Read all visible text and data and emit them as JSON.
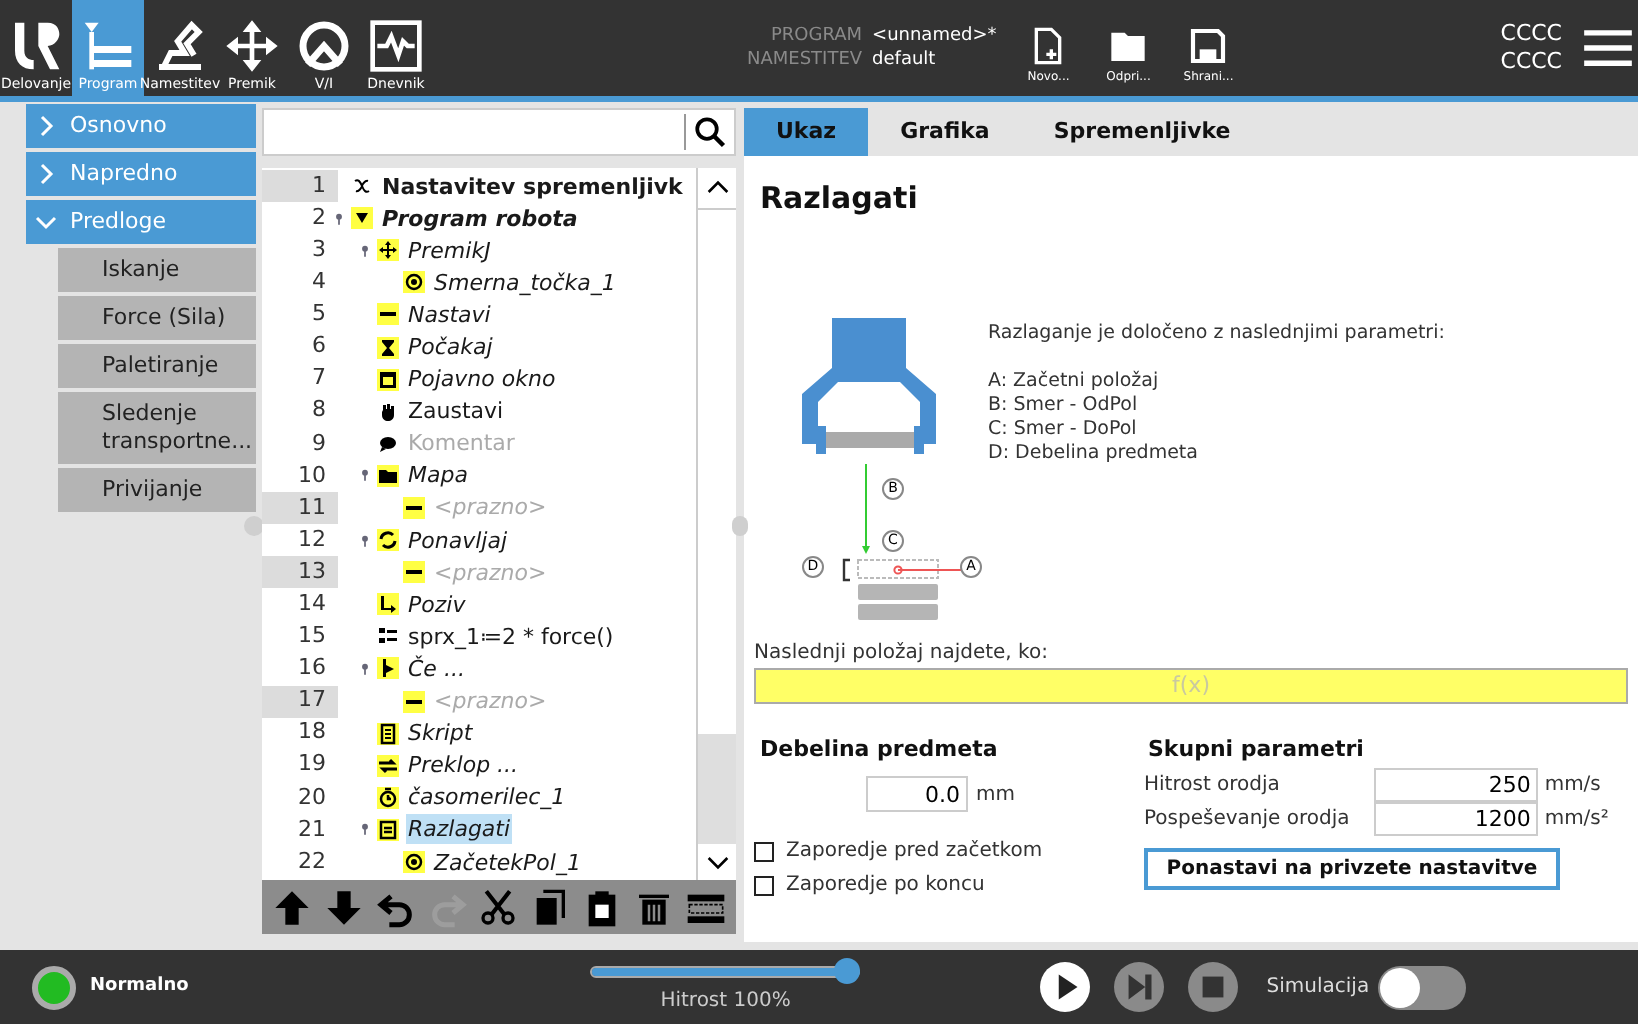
{
  "nav_tabs": [
    {
      "label": "Delovanje",
      "selected": false
    },
    {
      "label": "Program",
      "selected": true
    },
    {
      "label": "Namestitev",
      "selected": false
    },
    {
      "label": "Premik",
      "selected": false
    },
    {
      "label": "V/I",
      "selected": false
    },
    {
      "label": "Dnevnik",
      "selected": false
    }
  ],
  "program_info": [
    {
      "label": "PROGRAM",
      "value": "<unnamed>*"
    },
    {
      "label": "NAMESTITEV",
      "value": "default"
    }
  ],
  "file_buttons": [
    "Novo...",
    "Odpri...",
    "Shrani..."
  ],
  "header_texts": [
    "CCCC",
    "CCCC"
  ],
  "sidebar": [
    {
      "label": "Osnovno",
      "expanded": false
    },
    {
      "label": "Napredno",
      "expanded": false
    },
    {
      "label": "Predloge",
      "expanded": true,
      "children": [
        "Iskanje",
        "Force (Sila)",
        "Paletiranje",
        "Sledenje transportne...",
        "Privijanje"
      ]
    }
  ],
  "tree": [
    {
      "num": "1",
      "label": "Nastavitev spremenljivk",
      "kind": "vars",
      "bold": true,
      "italic": false,
      "greyed": false,
      "marked": true,
      "selected": false
    },
    {
      "num": "2",
      "label": "Program robota",
      "kind": "main",
      "bold": true,
      "italic": true,
      "greyed": false,
      "marked": false,
      "selected": false,
      "children": [
        {
          "num": "3",
          "label": "PremikJ",
          "kind": "move",
          "bold": false,
          "italic": true,
          "greyed": false,
          "marked": false,
          "selected": false,
          "children": [
            {
              "num": "4",
              "label": "Smerna_točka_1",
              "kind": "waypoint",
              "bold": false,
              "italic": true,
              "greyed": false,
              "marked": false,
              "selected": false
            }
          ]
        },
        {
          "num": "5",
          "label": "Nastavi",
          "kind": "dash",
          "bold": false,
          "italic": true,
          "greyed": false,
          "marked": false,
          "selected": false
        },
        {
          "num": "6",
          "label": "Počakaj",
          "kind": "wait",
          "bold": false,
          "italic": true,
          "greyed": false,
          "marked": false,
          "selected": false
        },
        {
          "num": "7",
          "label": "Pojavno okno",
          "kind": "popup",
          "bold": false,
          "italic": true,
          "greyed": false,
          "marked": false,
          "selected": false
        },
        {
          "num": "8",
          "label": "Zaustavi",
          "kind": "stop",
          "bold": false,
          "italic": false,
          "greyed": false,
          "marked": false,
          "selected": false
        },
        {
          "num": "9",
          "label": "Komentar",
          "kind": "comment",
          "bold": false,
          "italic": false,
          "greyed": true,
          "marked": false,
          "selected": false
        },
        {
          "num": "10",
          "label": "Mapa",
          "kind": "folder",
          "bold": false,
          "italic": true,
          "greyed": false,
          "marked": false,
          "selected": false,
          "children": [
            {
              "num": "11",
              "label": "<prazno>",
              "kind": "dash",
              "bold": false,
              "italic": true,
              "greyed": true,
              "marked": true,
              "selected": false
            }
          ]
        },
        {
          "num": "12",
          "label": "Ponavljaj",
          "kind": "loop",
          "bold": false,
          "italic": true,
          "greyed": false,
          "marked": false,
          "selected": false,
          "children": [
            {
              "num": "13",
              "label": "<prazno>",
              "kind": "dash",
              "bold": false,
              "italic": true,
              "greyed": true,
              "marked": true,
              "selected": false
            }
          ]
        },
        {
          "num": "14",
          "label": "Poziv",
          "kind": "call",
          "bold": false,
          "italic": true,
          "greyed": false,
          "marked": false,
          "selected": false
        },
        {
          "num": "15",
          "label": "sprx_1≔2 * force()",
          "kind": "assign",
          "bold": false,
          "italic": false,
          "greyed": false,
          "marked": false,
          "selected": false
        },
        {
          "num": "16",
          "label": "Če ...",
          "kind": "if",
          "bold": false,
          "italic": true,
          "greyed": false,
          "marked": false,
          "selected": false,
          "children": [
            {
              "num": "17",
              "label": "<prazno>",
              "kind": "dash",
              "bold": false,
              "italic": true,
              "greyed": true,
              "marked": true,
              "selected": false
            }
          ]
        },
        {
          "num": "18",
          "label": "Skript",
          "kind": "script",
          "bold": false,
          "italic": true,
          "greyed": false,
          "marked": false,
          "selected": false
        },
        {
          "num": "19",
          "label": "Preklop ...",
          "kind": "switch",
          "bold": false,
          "italic": true,
          "greyed": false,
          "marked": false,
          "selected": false
        },
        {
          "num": "20",
          "label": "časomerilec_1",
          "kind": "timer",
          "bold": false,
          "italic": true,
          "greyed": false,
          "marked": false,
          "selected": false
        },
        {
          "num": "21",
          "label": "Razlagati",
          "kind": "palletize",
          "bold": false,
          "italic": true,
          "greyed": false,
          "marked": false,
          "selected": true,
          "children": [
            {
              "num": "22",
              "label": "ZačetekPol_1",
              "kind": "waypoint",
              "bold": false,
              "italic": true,
              "greyed": false,
              "marked": false,
              "selected": false
            }
          ]
        }
      ]
    }
  ],
  "tree_tools": [
    {
      "disabled": false
    },
    {
      "disabled": false
    },
    {
      "disabled": false
    },
    {
      "disabled": true
    },
    {
      "disabled": false
    },
    {
      "disabled": false
    },
    {
      "disabled": false
    },
    {
      "disabled": false
    },
    {
      "disabled": false
    }
  ],
  "panel_tabs": [
    {
      "label": "Ukaz",
      "selected": true
    },
    {
      "label": "Grafika",
      "selected": false
    },
    {
      "label": "Spremenljivke",
      "selected": false
    }
  ],
  "command": {
    "title": "Razlagati",
    "diagram_labels": [
      "B",
      "C",
      "D",
      "A"
    ],
    "intro": "Razlaganje je določeno z naslednjimi parametri:",
    "params": [
      "A: Začetni položaj",
      "B: Smer - OdPol",
      "C: Smer - DoPol",
      "D: Debelina predmeta"
    ],
    "next_label": "Naslednji položaj najdete, ko:",
    "next_placeholder": "f(x)",
    "thickness": {
      "title": "Debelina predmeta",
      "value": "0.0",
      "unit": "mm"
    },
    "checkboxes": [
      {
        "label": "Zaporedje pred začetkom",
        "checked": false
      },
      {
        "label": "Zaporedje po koncu",
        "checked": false
      }
    ],
    "shared": {
      "title": "Skupni parametri",
      "rows": [
        {
          "label": "Hitrost orodja",
          "value": "250",
          "unit": "mm/s"
        },
        {
          "label": "Pospeševanje orodja",
          "value": "1200",
          "unit": "mm/s²"
        }
      ]
    },
    "reset_button": "Ponastavi na privzete nastavitve"
  },
  "footer": {
    "status": "Normalno",
    "speed": {
      "level": 1.0,
      "reading": "Hitrost 100%"
    },
    "simulation": {
      "label": "Simulacija",
      "on": false
    }
  }
}
